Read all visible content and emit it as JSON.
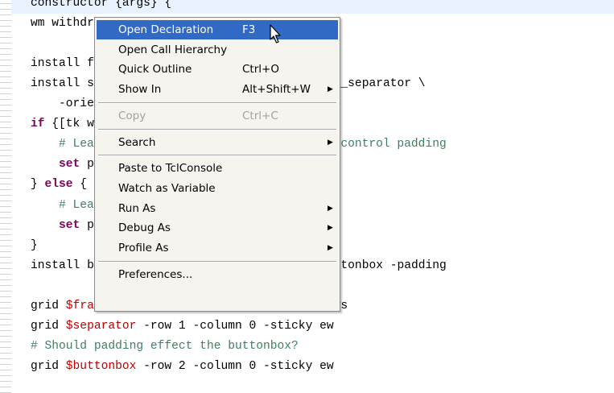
{
  "code_lines": [
    "constructor {args} {",
    "wm withdraw $win",
    "",
    "install frame using ttk::frame $win._frame",
    "install separator using ttk::separator $win._separator \\",
    "    -orient horizontal",
    "if {[tk windowingsystem] eq \"aqua\"} {",
    "    # Leave room for the aqua corner resize control padding",
    "    set pad {0 0 15 0}",
    "} else {",
    "    # Leave room for the Ttk buttonbox",
    "    set pad 0",
    "}",
    "install buttonbox using ttk::frame $win._buttonbox -padding",
    "",
    "grid $frame     -row 0 -column 0 -sticky news",
    "grid $separator -row 1 -column 0 -sticky ew",
    "# Should padding effect the buttonbox?",
    "grid $buttonbox -row 2 -column 0 -sticky ew"
  ],
  "context_menu": {
    "items": [
      {
        "label": "Open Declaration",
        "accel": "F3",
        "highlighted": true
      },
      {
        "label": "Open Call Hierarchy"
      },
      {
        "label": "Quick Outline",
        "accel": "Ctrl+O"
      },
      {
        "label": "Show In",
        "accel": "Alt+Shift+W",
        "submenu": true
      },
      {
        "separator": true
      },
      {
        "label": "Copy",
        "accel": "Ctrl+C",
        "disabled": true
      },
      {
        "separator": true
      },
      {
        "label": "Search",
        "submenu": true
      },
      {
        "separator": true
      },
      {
        "label": "Paste to TclConsole"
      },
      {
        "label": "Watch as Variable"
      },
      {
        "label": "Run As",
        "submenu": true
      },
      {
        "label": "Debug As",
        "submenu": true
      },
      {
        "label": "Profile As",
        "submenu": true
      },
      {
        "separator": true
      },
      {
        "label": "Preferences..."
      }
    ]
  },
  "colors": {
    "keyword": "#7f0055",
    "variable": "#c00000",
    "string": "#2a00ff",
    "comment": "#3f7f5f",
    "current_line": "#e8f2fe",
    "menu_bg": "#f5f4ef",
    "menu_highlight": "#316ac5"
  },
  "icons": {
    "submenu_arrow": "submenu-arrow-icon",
    "cursor": "mouse-pointer-icon"
  }
}
